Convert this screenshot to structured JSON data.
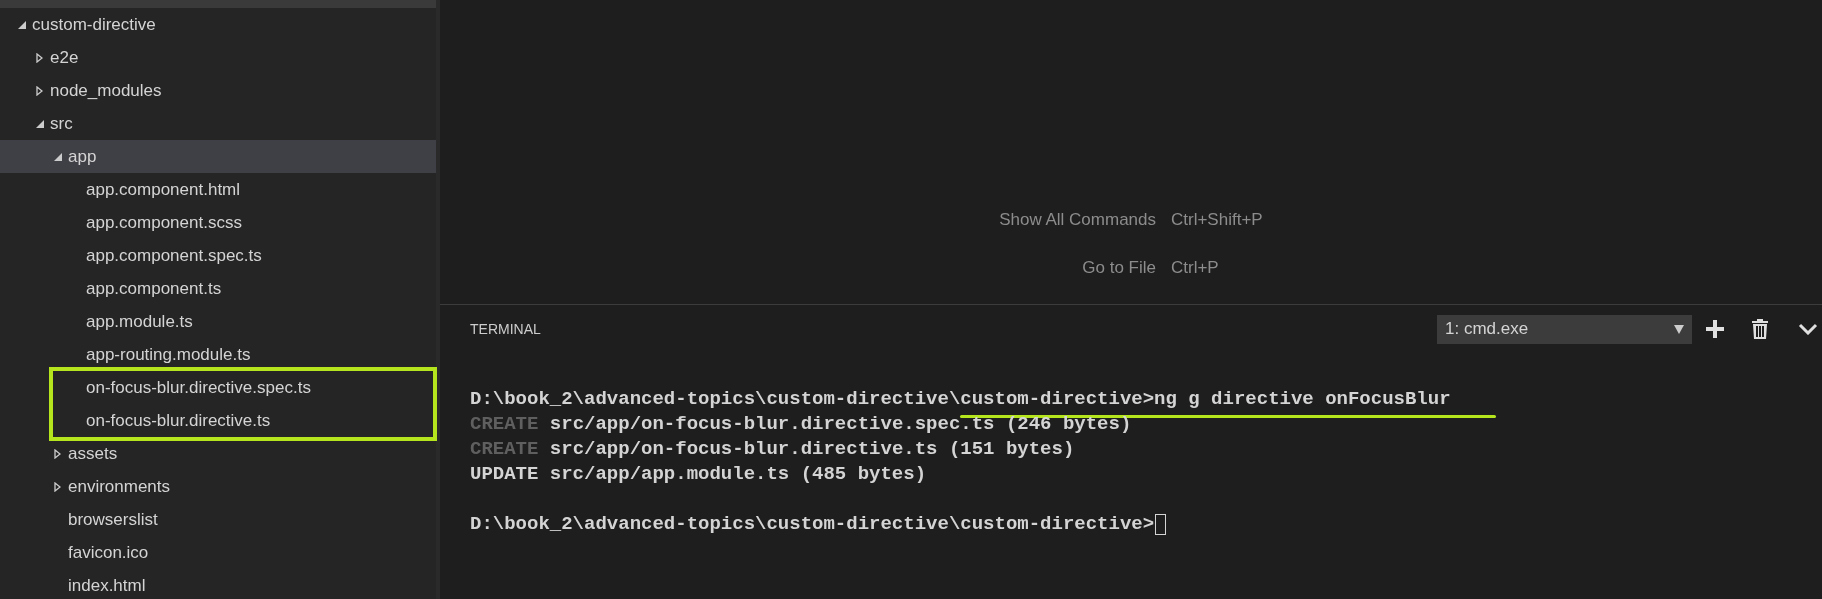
{
  "explorer": {
    "tree": [
      {
        "kind": "folder",
        "label": "custom-directive",
        "expanded": true,
        "selected": false,
        "children": [
          {
            "kind": "folder",
            "label": "e2e",
            "expanded": false,
            "selected": false
          },
          {
            "kind": "folder",
            "label": "node_modules",
            "expanded": false,
            "selected": false
          },
          {
            "kind": "folder",
            "label": "src",
            "expanded": true,
            "selected": false,
            "children": [
              {
                "kind": "folder",
                "label": "app",
                "expanded": true,
                "selected": true,
                "children": [
                  {
                    "kind": "file",
                    "label": "app.component.html",
                    "selected": false,
                    "highlighted": false
                  },
                  {
                    "kind": "file",
                    "label": "app.component.scss",
                    "selected": false,
                    "highlighted": false
                  },
                  {
                    "kind": "file",
                    "label": "app.component.spec.ts",
                    "selected": false,
                    "highlighted": false
                  },
                  {
                    "kind": "file",
                    "label": "app.component.ts",
                    "selected": false,
                    "highlighted": false
                  },
                  {
                    "kind": "file",
                    "label": "app.module.ts",
                    "selected": false,
                    "highlighted": false
                  },
                  {
                    "kind": "file",
                    "label": "app-routing.module.ts",
                    "selected": false,
                    "highlighted": false
                  },
                  {
                    "kind": "file",
                    "label": "on-focus-blur.directive.spec.ts",
                    "selected": false,
                    "highlighted": true
                  },
                  {
                    "kind": "file",
                    "label": "on-focus-blur.directive.ts",
                    "selected": false,
                    "highlighted": true
                  }
                ]
              },
              {
                "kind": "folder",
                "label": "assets",
                "expanded": false,
                "selected": false
              },
              {
                "kind": "folder",
                "label": "environments",
                "expanded": false,
                "selected": false
              },
              {
                "kind": "file",
                "label": "browserslist",
                "selected": false,
                "highlighted": false
              },
              {
                "kind": "file",
                "label": "favicon.ico",
                "selected": false,
                "highlighted": false
              },
              {
                "kind": "file",
                "label": "index.html",
                "selected": false,
                "highlighted": false
              }
            ]
          }
        ]
      }
    ]
  },
  "shortcuts": [
    {
      "label": "Show All Commands",
      "keys": "Ctrl+Shift+P"
    },
    {
      "label": "Go to File",
      "keys": "Ctrl+P"
    }
  ],
  "terminal": {
    "title": "TERMINAL",
    "selector": "1: cmd.exe",
    "lines": [
      {
        "segments": [
          {
            "text": "D:\\book_2\\advanced-topics\\custom-directive\\",
            "dim": false
          },
          {
            "text": "custom-directive>ng g directive onFocusBlur",
            "dim": false,
            "underlined": true
          }
        ],
        "cursor": false
      },
      {
        "segments": [
          {
            "text": "CREATE",
            "dim": true
          },
          {
            "text": " src/app/on-focus-blur.directive.spec.ts (246 bytes)",
            "dim": false
          }
        ],
        "cursor": false
      },
      {
        "segments": [
          {
            "text": "CREATE",
            "dim": true
          },
          {
            "text": " src/app/on-focus-blur.directive.ts (151 bytes)",
            "dim": false
          }
        ],
        "cursor": false
      },
      {
        "segments": [
          {
            "text": "UPDATE src/app/app.module.ts (485 bytes)",
            "dim": false
          }
        ],
        "cursor": false
      },
      {
        "cursor": false
      },
      {
        "segments": [
          {
            "text": "D:\\book_2\\advanced-topics\\custom-directive\\custom-directive>",
            "dim": false
          }
        ],
        "cursor": true
      }
    ]
  }
}
